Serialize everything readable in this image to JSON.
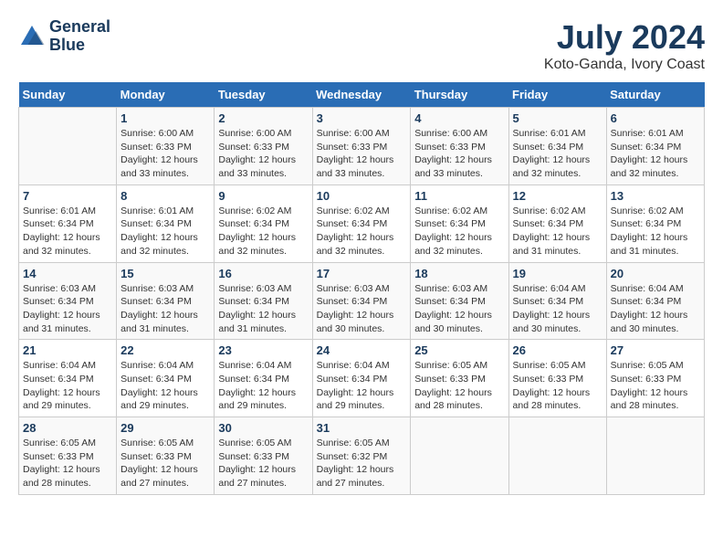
{
  "header": {
    "logo_line1": "General",
    "logo_line2": "Blue",
    "month_title": "July 2024",
    "location": "Koto-Ganda, Ivory Coast"
  },
  "weekdays": [
    "Sunday",
    "Monday",
    "Tuesday",
    "Wednesday",
    "Thursday",
    "Friday",
    "Saturday"
  ],
  "weeks": [
    [
      {
        "day": "",
        "info": ""
      },
      {
        "day": "1",
        "info": "Sunrise: 6:00 AM\nSunset: 6:33 PM\nDaylight: 12 hours\nand 33 minutes."
      },
      {
        "day": "2",
        "info": "Sunrise: 6:00 AM\nSunset: 6:33 PM\nDaylight: 12 hours\nand 33 minutes."
      },
      {
        "day": "3",
        "info": "Sunrise: 6:00 AM\nSunset: 6:33 PM\nDaylight: 12 hours\nand 33 minutes."
      },
      {
        "day": "4",
        "info": "Sunrise: 6:00 AM\nSunset: 6:33 PM\nDaylight: 12 hours\nand 33 minutes."
      },
      {
        "day": "5",
        "info": "Sunrise: 6:01 AM\nSunset: 6:34 PM\nDaylight: 12 hours\nand 32 minutes."
      },
      {
        "day": "6",
        "info": "Sunrise: 6:01 AM\nSunset: 6:34 PM\nDaylight: 12 hours\nand 32 minutes."
      }
    ],
    [
      {
        "day": "7",
        "info": "Sunrise: 6:01 AM\nSunset: 6:34 PM\nDaylight: 12 hours\nand 32 minutes."
      },
      {
        "day": "8",
        "info": "Sunrise: 6:01 AM\nSunset: 6:34 PM\nDaylight: 12 hours\nand 32 minutes."
      },
      {
        "day": "9",
        "info": "Sunrise: 6:02 AM\nSunset: 6:34 PM\nDaylight: 12 hours\nand 32 minutes."
      },
      {
        "day": "10",
        "info": "Sunrise: 6:02 AM\nSunset: 6:34 PM\nDaylight: 12 hours\nand 32 minutes."
      },
      {
        "day": "11",
        "info": "Sunrise: 6:02 AM\nSunset: 6:34 PM\nDaylight: 12 hours\nand 32 minutes."
      },
      {
        "day": "12",
        "info": "Sunrise: 6:02 AM\nSunset: 6:34 PM\nDaylight: 12 hours\nand 31 minutes."
      },
      {
        "day": "13",
        "info": "Sunrise: 6:02 AM\nSunset: 6:34 PM\nDaylight: 12 hours\nand 31 minutes."
      }
    ],
    [
      {
        "day": "14",
        "info": "Sunrise: 6:03 AM\nSunset: 6:34 PM\nDaylight: 12 hours\nand 31 minutes."
      },
      {
        "day": "15",
        "info": "Sunrise: 6:03 AM\nSunset: 6:34 PM\nDaylight: 12 hours\nand 31 minutes."
      },
      {
        "day": "16",
        "info": "Sunrise: 6:03 AM\nSunset: 6:34 PM\nDaylight: 12 hours\nand 31 minutes."
      },
      {
        "day": "17",
        "info": "Sunrise: 6:03 AM\nSunset: 6:34 PM\nDaylight: 12 hours\nand 30 minutes."
      },
      {
        "day": "18",
        "info": "Sunrise: 6:03 AM\nSunset: 6:34 PM\nDaylight: 12 hours\nand 30 minutes."
      },
      {
        "day": "19",
        "info": "Sunrise: 6:04 AM\nSunset: 6:34 PM\nDaylight: 12 hours\nand 30 minutes."
      },
      {
        "day": "20",
        "info": "Sunrise: 6:04 AM\nSunset: 6:34 PM\nDaylight: 12 hours\nand 30 minutes."
      }
    ],
    [
      {
        "day": "21",
        "info": "Sunrise: 6:04 AM\nSunset: 6:34 PM\nDaylight: 12 hours\nand 29 minutes."
      },
      {
        "day": "22",
        "info": "Sunrise: 6:04 AM\nSunset: 6:34 PM\nDaylight: 12 hours\nand 29 minutes."
      },
      {
        "day": "23",
        "info": "Sunrise: 6:04 AM\nSunset: 6:34 PM\nDaylight: 12 hours\nand 29 minutes."
      },
      {
        "day": "24",
        "info": "Sunrise: 6:04 AM\nSunset: 6:34 PM\nDaylight: 12 hours\nand 29 minutes."
      },
      {
        "day": "25",
        "info": "Sunrise: 6:05 AM\nSunset: 6:33 PM\nDaylight: 12 hours\nand 28 minutes."
      },
      {
        "day": "26",
        "info": "Sunrise: 6:05 AM\nSunset: 6:33 PM\nDaylight: 12 hours\nand 28 minutes."
      },
      {
        "day": "27",
        "info": "Sunrise: 6:05 AM\nSunset: 6:33 PM\nDaylight: 12 hours\nand 28 minutes."
      }
    ],
    [
      {
        "day": "28",
        "info": "Sunrise: 6:05 AM\nSunset: 6:33 PM\nDaylight: 12 hours\nand 28 minutes."
      },
      {
        "day": "29",
        "info": "Sunrise: 6:05 AM\nSunset: 6:33 PM\nDaylight: 12 hours\nand 27 minutes."
      },
      {
        "day": "30",
        "info": "Sunrise: 6:05 AM\nSunset: 6:33 PM\nDaylight: 12 hours\nand 27 minutes."
      },
      {
        "day": "31",
        "info": "Sunrise: 6:05 AM\nSunset: 6:32 PM\nDaylight: 12 hours\nand 27 minutes."
      },
      {
        "day": "",
        "info": ""
      },
      {
        "day": "",
        "info": ""
      },
      {
        "day": "",
        "info": ""
      }
    ]
  ]
}
